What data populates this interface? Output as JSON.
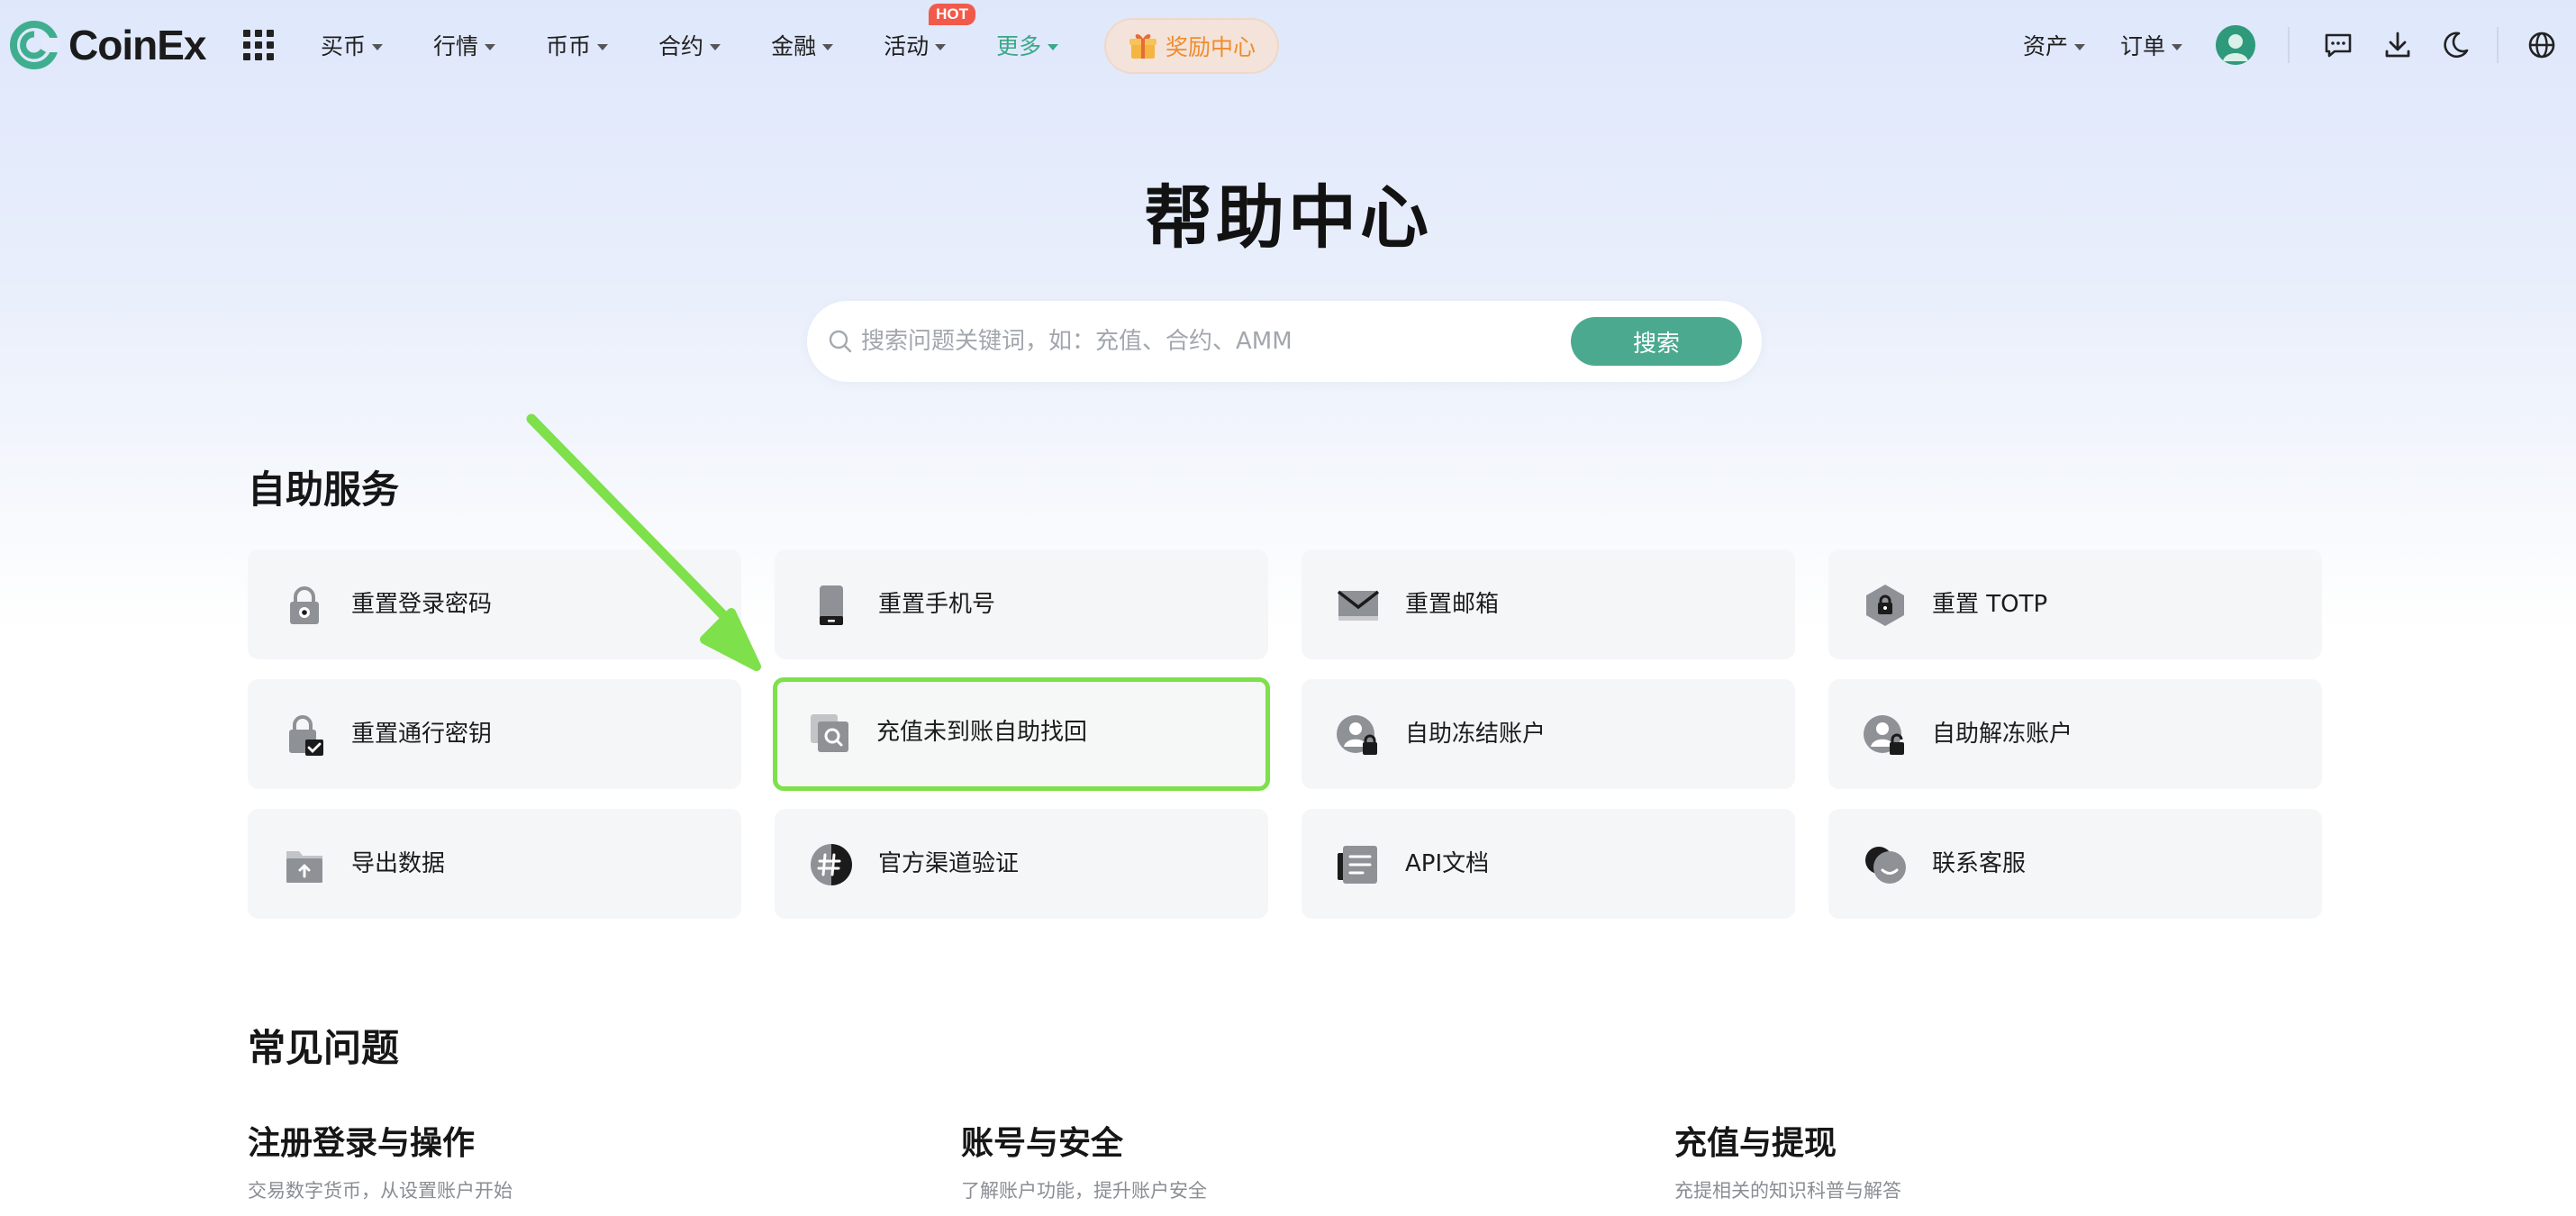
{
  "brand": {
    "name": "CoinEx",
    "accent": "#4ba98f",
    "highlight": "#7ee04a"
  },
  "nav": {
    "items": [
      {
        "label": "买币"
      },
      {
        "label": "行情"
      },
      {
        "label": "币币"
      },
      {
        "label": "合约"
      },
      {
        "label": "金融"
      },
      {
        "label": "活动",
        "badge": "HOT"
      },
      {
        "label": "更多",
        "active": true
      }
    ],
    "reward": "奖励中心"
  },
  "header_right": {
    "assets": "资产",
    "orders": "订单",
    "icons": [
      "avatar",
      "message-icon",
      "download-icon",
      "moon-icon",
      "globe-icon"
    ]
  },
  "hero": {
    "title": "帮助中心",
    "search_placeholder": "搜索问题关键词，如：充值、合约、AMM",
    "search_button": "搜索"
  },
  "self_service": {
    "title": "自助服务",
    "cards": [
      {
        "label": "重置登录密码",
        "icon": "lock-icon"
      },
      {
        "label": "重置手机号",
        "icon": "phone-icon"
      },
      {
        "label": "重置邮箱",
        "icon": "mail-icon"
      },
      {
        "label": "重置 TOTP",
        "icon": "shield-lock-icon"
      },
      {
        "label": "重置通行密钥",
        "icon": "passkey-icon"
      },
      {
        "label": "充值未到账自助找回",
        "icon": "deposit-search-icon",
        "highlighted": true
      },
      {
        "label": "自助冻结账户",
        "icon": "user-lock-icon"
      },
      {
        "label": "自助解冻账户",
        "icon": "user-unlock-icon"
      },
      {
        "label": "导出数据",
        "icon": "folder-export-icon"
      },
      {
        "label": "官方渠道验证",
        "icon": "verify-channel-icon"
      },
      {
        "label": "API文档",
        "icon": "api-doc-icon"
      },
      {
        "label": "联系客服",
        "icon": "chat-support-icon"
      }
    ]
  },
  "faq": {
    "title": "常见问题",
    "categories": [
      {
        "title": "注册登录与操作",
        "subtitle": "交易数字货币，从设置账户开始"
      },
      {
        "title": "账号与安全",
        "subtitle": "了解账户功能，提升账户安全"
      },
      {
        "title": "充值与提现",
        "subtitle": "充提相关的知识科普与解答"
      }
    ]
  }
}
